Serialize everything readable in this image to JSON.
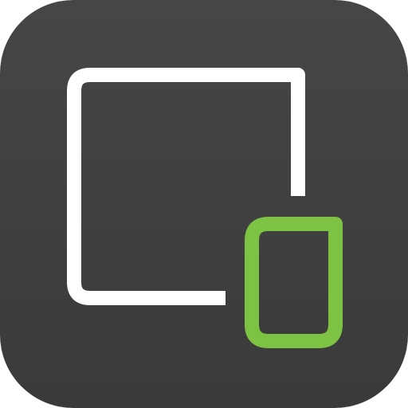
{
  "app_icon": {
    "icon": "window-with-phone-icon",
    "colors": {
      "background_top": "#464646",
      "background_bottom": "#3a3a3a",
      "frame_stroke": "#ffffff",
      "device_stroke": "#7dc243"
    }
  }
}
